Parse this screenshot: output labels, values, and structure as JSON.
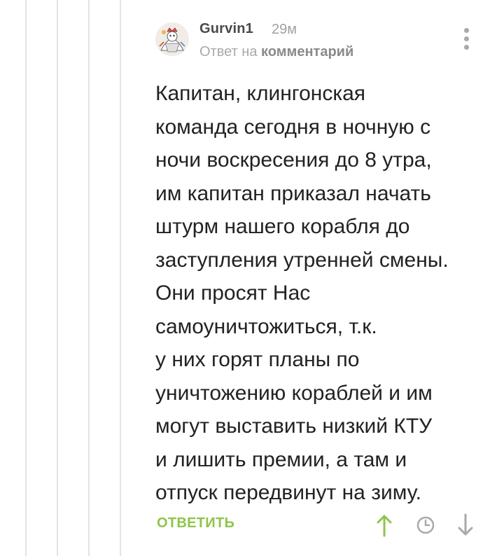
{
  "comment": {
    "author": "Gurvin1",
    "time": "29м",
    "reply_prefix": "Ответ на",
    "reply_link": "комментарий",
    "text": "Капитан, клингонская\nкоманда сегодня в ночную с\nночи воскресения до 8 утра,\nим капитан приказал начать\nштурм нашего корабля до\nзаступления утренней смены.\n Они просят Нас\nсамоуничтожиться, т.к.\nу них горят планы по\nуничтожению кораблей и им\nмогут выставить низкий КТУ\nи лишить премии, а там и\nотпуск передвинут на зиму.",
    "reply_button": "ОТВЕТИТЬ"
  },
  "icons": {
    "upvote": "arrow-up-icon",
    "time": "clock-icon",
    "downvote": "arrow-down-icon",
    "menu": "more-vertical-icon",
    "avatar": "avatar-illustration"
  },
  "colors": {
    "accent_green": "#8fc44a",
    "muted_gray": "#a9a9a9",
    "thread_line": "#e3e3e3",
    "text": "#222222"
  }
}
